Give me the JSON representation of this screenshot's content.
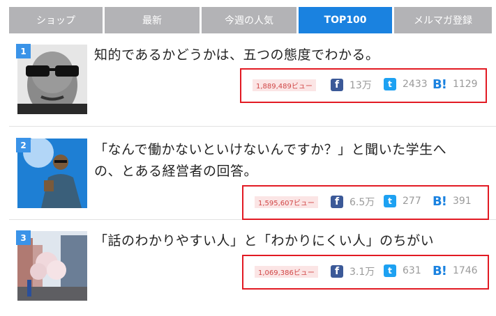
{
  "tabs": [
    {
      "label": "ショップ",
      "active": false
    },
    {
      "label": "最新",
      "active": false
    },
    {
      "label": "今週の人気",
      "active": false
    },
    {
      "label": "TOP100",
      "active": true
    },
    {
      "label": "メルマガ登録",
      "active": false
    }
  ],
  "colors": {
    "accent": "#1a82e0",
    "tab_bg": "#b3b3b6",
    "highlight_border": "#e21a23",
    "views_bg": "#fbe5e5",
    "views_text": "#d04646"
  },
  "articles": [
    {
      "rank": "1",
      "title_lines": [
        "知的であるかどうかは、五つの態度でわかる。"
      ],
      "views": "1,889,489ビュー",
      "facebook": "13万",
      "twitter": "2433",
      "hatena": "1129"
    },
    {
      "rank": "2",
      "title_lines": [
        "「なんで働かないといけないんですか？」と聞いた学生へ",
        "の、とある経営者の回答。"
      ],
      "views": "1,595,607ビュー",
      "facebook": "6.5万",
      "twitter": "277",
      "hatena": "391"
    },
    {
      "rank": "3",
      "title_lines": [
        "「話のわかりやすい人」と「わかりにくい人」のちがい"
      ],
      "views": "1,069,386ビュー",
      "facebook": "3.1万",
      "twitter": "631",
      "hatena": "1746"
    }
  ],
  "icons": {
    "facebook": "facebook-icon",
    "twitter": "twitter-icon",
    "hatena": "hatena-bookmark-icon"
  }
}
